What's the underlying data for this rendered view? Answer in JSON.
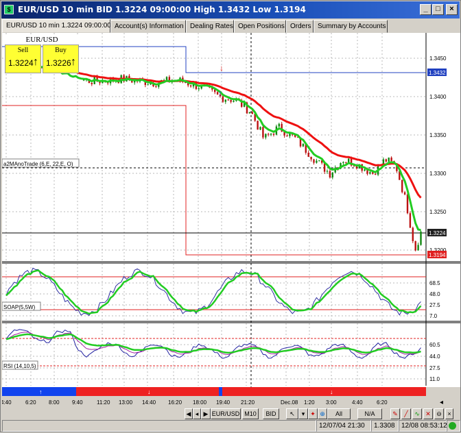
{
  "window": {
    "title": "EUR/USD 10 min BID 1.3224 09:00:00 High 1.3432 Low 1.3194",
    "icon": "app-icon",
    "controls": [
      "minimize-icon",
      "maximize-icon",
      "close-icon"
    ]
  },
  "tabs": [
    {
      "label": "EUR/USD 10 min 1.3224 09:00:00",
      "active": true
    },
    {
      "label": "Account(s) Information",
      "active": false
    },
    {
      "label": "Dealing Rates",
      "active": false
    },
    {
      "label": "Open Positions",
      "active": false
    },
    {
      "label": "Orders",
      "active": false
    },
    {
      "label": "Summary by Accounts",
      "active": false
    }
  ],
  "quote": {
    "symbol": "EUR/USD",
    "sell_label": "Sell",
    "sell_price": "1.3224",
    "buy_label": "Buy",
    "buy_price": "1.3226",
    "arrow": "↑"
  },
  "price_panel": {
    "y_ticks": [
      "1.3450",
      "1.3400",
      "1.3350",
      "1.3300",
      "1.3250",
      "1.3200"
    ],
    "markers": [
      {
        "text": "1.3432",
        "bg": "#2040c0"
      },
      {
        "text": "1.3224",
        "bg": "#202020"
      },
      {
        "text": "1.3194",
        "bg": "#e02020"
      }
    ],
    "indicator_label": "a2MAnoTrade (6,E, 22,E, O)",
    "fast_ma_color": "#22cc22",
    "slow_ma_color": "#ee1111"
  },
  "soap_panel": {
    "label": "SOAP(5,5W)",
    "y_ticks": [
      "68.5",
      "48.0",
      "27.5",
      "7.0"
    ]
  },
  "rsi_panel": {
    "label": "RSI (14,10,5)",
    "y_ticks": [
      "60.5",
      "44.0",
      "27.5",
      "11.0"
    ]
  },
  "x_ticks": [
    "4:40",
    "6:20",
    "8:00",
    "9:40",
    "11:20",
    "13:00",
    "14:40",
    "16:20",
    "18:00",
    "19:40",
    "21:20",
    "Dec.08",
    "1:20",
    "3:00",
    "4:40",
    "6:20"
  ],
  "signal_bar": {
    "buy_color": "#1144ee",
    "sell_color": "#ee2222"
  },
  "toolbar": {
    "symbol": "EUR/USD",
    "timeframe": "M10",
    "side": "BID",
    "range": "All",
    "na": "N/A"
  },
  "status": {
    "cursor_time": "12/07/04 21:30",
    "cursor_price": "1.3308",
    "clock": "12/08 08:53:12"
  }
}
